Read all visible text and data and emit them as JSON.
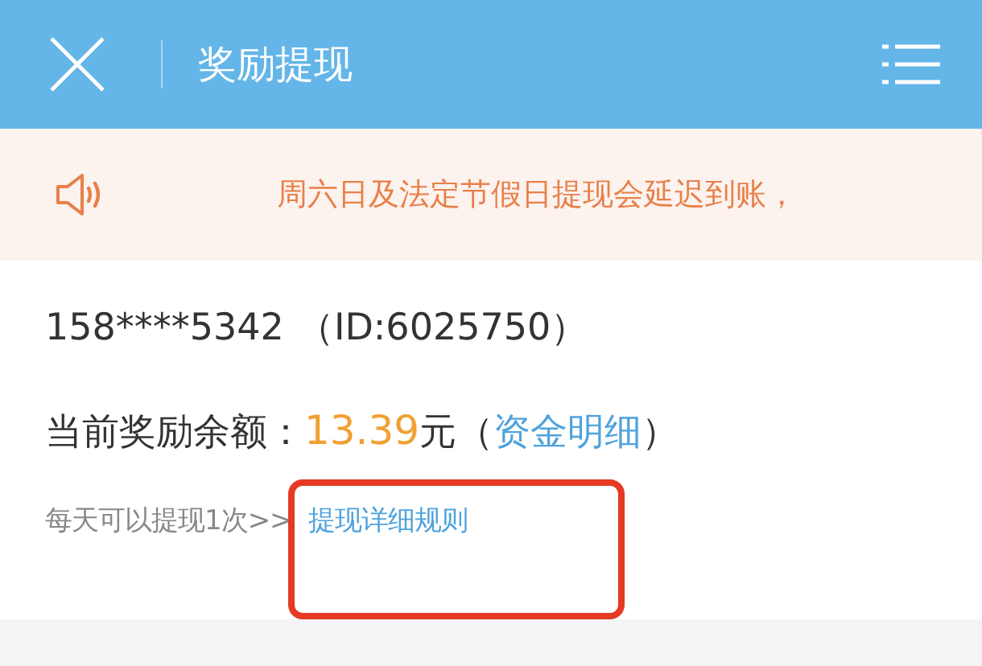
{
  "header": {
    "title": "奖励提现"
  },
  "notice": {
    "text": "周六日及法定节假日提现会延迟到账，"
  },
  "account": {
    "phone": "158****5342",
    "id_text": "（ID:6025750）"
  },
  "balance": {
    "label": "当前奖励余额：",
    "amount": "13.39",
    "unit": "元",
    "open_paren": "（",
    "link": "资金明细",
    "close_paren": "）"
  },
  "rules": {
    "text": "每天可以提现1次>>",
    "link": "提现详细规则"
  }
}
